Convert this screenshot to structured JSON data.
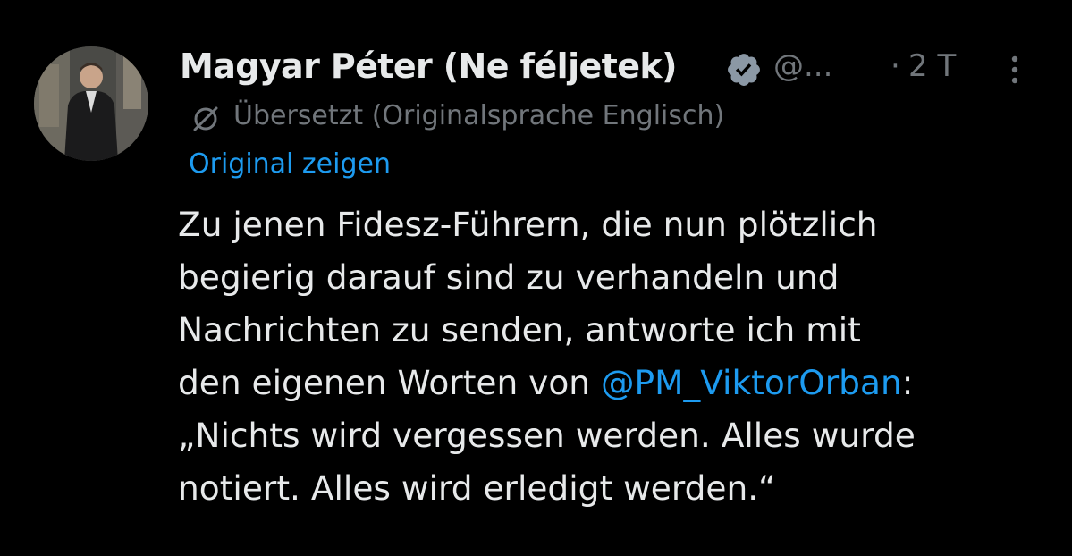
{
  "tweet": {
    "author": {
      "display_name": "Magyar Péter (Ne féljetek)",
      "handle": "@...",
      "verified_icon": "verified-badge-icon",
      "verified_color": "#8b98a5"
    },
    "time_separator": "·",
    "time": "2 T",
    "translation": {
      "icon": "translate-globe-icon",
      "label": "Übersetzt (Originalsprache Englisch)",
      "show_original": "Original zeigen"
    },
    "body": {
      "line1": "Zu jenen Fidesz-Führern, die nun plötzlich",
      "line2": "begierig darauf sind zu verhandeln und",
      "line3": "Nachrichten zu senden, antworte ich mit",
      "line4_prefix": "den eigenen Worten von ",
      "mention": "@PM_ViktorOrban",
      "line4_suffix": ":",
      "line5": "„Nichts wird vergessen werden. Alles wurde",
      "line6": "notiert. Alles wird erledigt werden.“"
    }
  },
  "colors": {
    "background": "#000000",
    "text_primary": "#e7e9ea",
    "text_secondary": "#71767b",
    "link": "#1d9bf0",
    "divider": "#2f3336"
  }
}
